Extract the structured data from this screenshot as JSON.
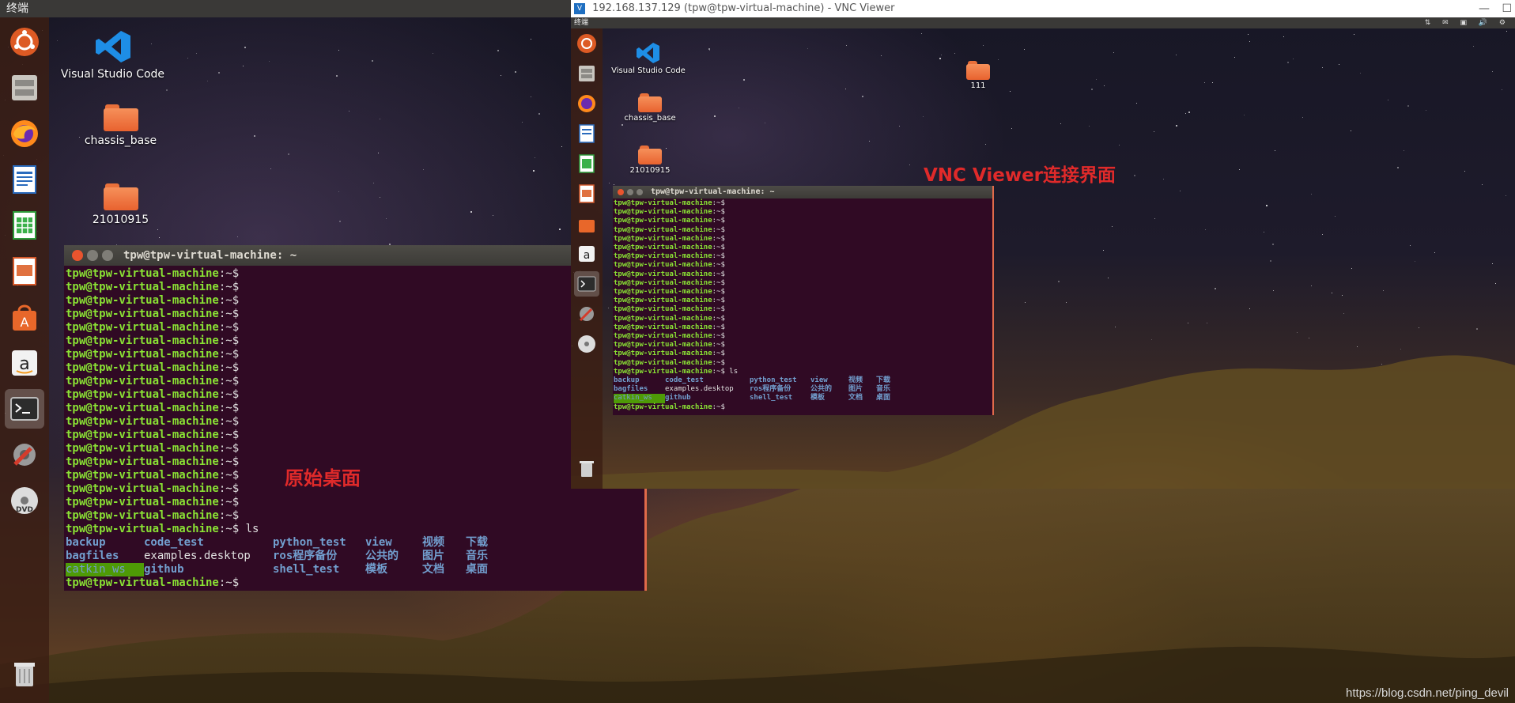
{
  "local": {
    "topbar_title": "终端",
    "desktop_icons": [
      "Visual Studio Code",
      "chassis_base",
      "21010915"
    ],
    "terminal": {
      "title": "tpw@tpw-virtual-machine: ~",
      "prompt": "tpw@tpw-virtual-machine",
      "prompt_suffix": ":~$",
      "empty_prompt_count": 19,
      "command": " ls",
      "ls_rows": [
        [
          {
            "t": "backup",
            "c": "dir"
          },
          {
            "t": "code_test",
            "c": "dir"
          },
          {
            "t": "python_test",
            "c": "dir"
          },
          {
            "t": "view",
            "c": "dir"
          },
          {
            "t": "视频",
            "c": "dir"
          },
          {
            "t": "下载",
            "c": "dir"
          }
        ],
        [
          {
            "t": "bagfiles",
            "c": "dir"
          },
          {
            "t": "examples.desktop",
            "c": "file"
          },
          {
            "t": "ros程序备份",
            "c": "dir"
          },
          {
            "t": "公共的",
            "c": "dir"
          },
          {
            "t": "图片",
            "c": "dir"
          },
          {
            "t": "音乐",
            "c": "dir"
          }
        ],
        [
          {
            "t": "catkin_ws",
            "c": "hl"
          },
          {
            "t": "github",
            "c": "dir"
          },
          {
            "t": "shell_test",
            "c": "dir"
          },
          {
            "t": "模板",
            "c": "dir"
          },
          {
            "t": "文档",
            "c": "dir"
          },
          {
            "t": "桌面",
            "c": "dir"
          }
        ]
      ]
    },
    "annotation": "原始桌面"
  },
  "vnc": {
    "window_title": "192.168.137.129 (tpw@tpw-virtual-machine) - VNC Viewer",
    "topbar_title": "终端",
    "desktop_icons": [
      "Visual Studio Code",
      "chassis_base",
      "21010915",
      "111"
    ],
    "terminal": {
      "title": "tpw@tpw-virtual-machine: ~",
      "empty_prompt_count": 19
    },
    "annotation": "VNC Viewer连接界面"
  },
  "watermark": "https://blog.csdn.net/ping_devil"
}
